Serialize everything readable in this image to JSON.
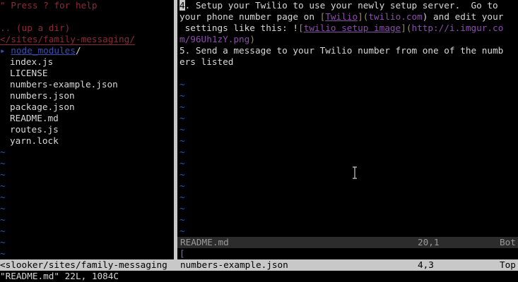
{
  "nerdtree": {
    "help_hint": "\" Press ? for help",
    "up_dir": ".. (up a dir)",
    "cwd": "</sites/family-messaging/",
    "root_dir_marker": "▸",
    "root_dir": "node_modules",
    "root_dir_slash": "/",
    "files": [
      "index.js",
      "LICENSE",
      "numbers-example.json",
      "numbers.json",
      "package.json",
      "README.md",
      "routes.js",
      "yarn.lock"
    ],
    "tilde": "~"
  },
  "readme": {
    "line1_cursor": "4",
    "line1_rest": ". Setup your Twilio to use your newly setup server.  Go to",
    "line2_a": "your phone number page on ",
    "line2_b_open": "[",
    "line2_link": "Twilio",
    "line2_b_close": "](",
    "line2_url": "twilio.com",
    "line2_c": ") and edit your",
    "line3_a": " settings like this: !",
    "line3_b_open": "[",
    "line3_link": "twilio setup image",
    "line3_b_close": "](",
    "line3_url": "http://i.imgur.co",
    "line4_url": "m/96Uh1zY.png",
    "line4_close": ")",
    "line5": "5. Send a message to your Twilio number from one of the numb",
    "line6": "ers listed",
    "tilde": "~"
  },
  "status": {
    "readme_name": "README.md",
    "readme_pos": "20,1",
    "readme_pct": "Bot",
    "json_name": "numbers-example.json",
    "json_pos": "4,3",
    "json_pct": "Top",
    "tree_path": "<slooker/sites/family-messaging"
  },
  "json_window": {
    "first_line": "["
  },
  "cmdline": {
    "text": "\"README.md\" 22L, 1084C"
  }
}
